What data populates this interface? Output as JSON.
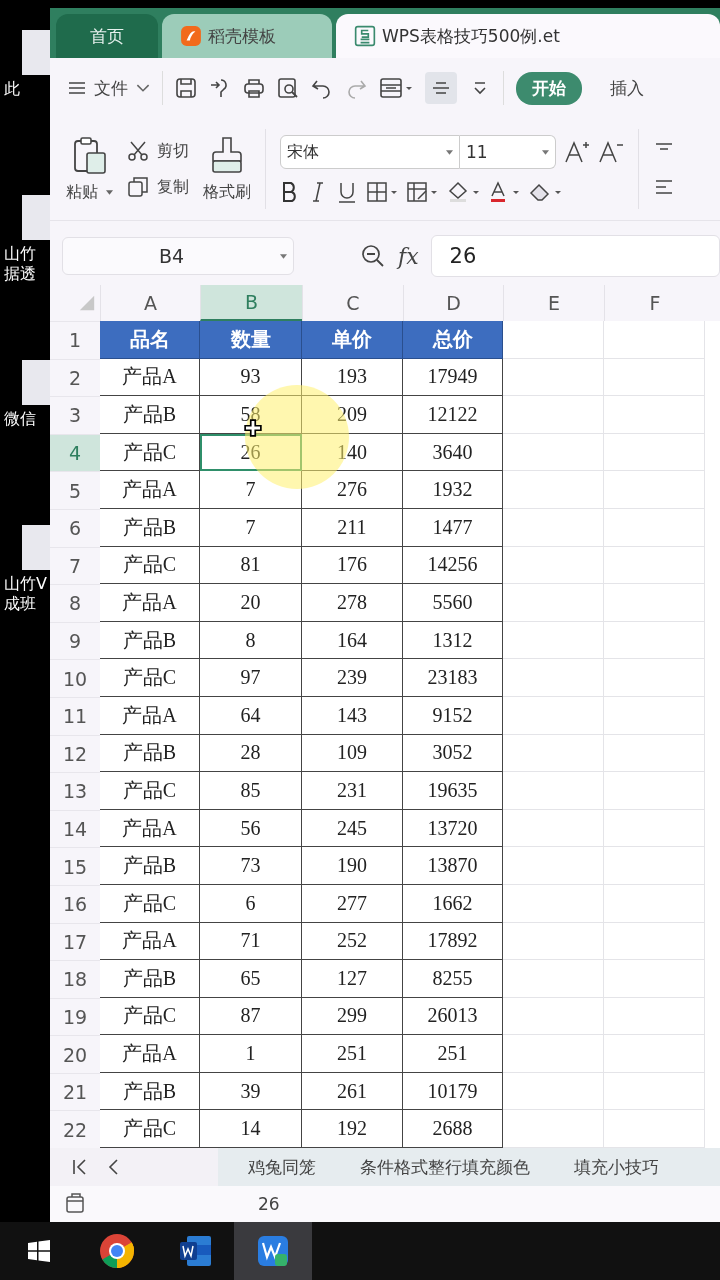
{
  "desktop_icons": [
    {
      "lines": [
        "此"
      ]
    },
    {
      "lines": [
        "山竹",
        "据透"
      ]
    },
    {
      "lines": [
        "微信"
      ]
    },
    {
      "lines": [
        "山竹V",
        "成班"
      ]
    }
  ],
  "tabs": [
    {
      "label": "首页",
      "kind": "home",
      "selected": false
    },
    {
      "label": "稻壳模板",
      "kind": "template",
      "selected": false
    },
    {
      "label": "WPS表格技巧500例.et",
      "kind": "document",
      "selected": true
    }
  ],
  "toolbar": {
    "file_menu": "文件"
  },
  "ribbon_tabs": [
    {
      "label": "开始",
      "selected": true
    },
    {
      "label": "插入",
      "selected": false
    }
  ],
  "ribbon": {
    "paste": "粘贴",
    "cut": "剪切",
    "copy": "复制",
    "format_painter": "格式刷",
    "font": "宋体",
    "font_size": "11"
  },
  "formula_bar": {
    "name_box": "B4",
    "fx": "fx",
    "value": "26"
  },
  "sheet": {
    "columns": [
      {
        "label": "A",
        "selected": false
      },
      {
        "label": "B",
        "selected": true
      },
      {
        "label": "C",
        "selected": false
      },
      {
        "label": "D",
        "selected": false
      },
      {
        "label": "E",
        "selected": false
      },
      {
        "label": "F",
        "selected": false
      }
    ],
    "rows": [
      {
        "number": "1",
        "kind": "header",
        "selected": false,
        "cells": [
          "品名",
          "数量",
          "单价",
          "总价"
        ]
      },
      {
        "number": "2",
        "kind": "data",
        "selected": false,
        "cells": [
          "产品A",
          "93",
          "193",
          "17949"
        ]
      },
      {
        "number": "3",
        "kind": "data",
        "selected": false,
        "cells": [
          "产品B",
          "58",
          "209",
          "12122"
        ]
      },
      {
        "number": "4",
        "kind": "data",
        "selected": true,
        "cells": [
          "产品C",
          "26",
          "140",
          "3640"
        ]
      },
      {
        "number": "5",
        "kind": "data",
        "selected": false,
        "cells": [
          "产品A",
          "7",
          "276",
          "1932"
        ]
      },
      {
        "number": "6",
        "kind": "data",
        "selected": false,
        "cells": [
          "产品B",
          "7",
          "211",
          "1477"
        ]
      },
      {
        "number": "7",
        "kind": "data",
        "selected": false,
        "cells": [
          "产品C",
          "81",
          "176",
          "14256"
        ]
      },
      {
        "number": "8",
        "kind": "data",
        "selected": false,
        "cells": [
          "产品A",
          "20",
          "278",
          "5560"
        ]
      },
      {
        "number": "9",
        "kind": "data",
        "selected": false,
        "cells": [
          "产品B",
          "8",
          "164",
          "1312"
        ]
      },
      {
        "number": "10",
        "kind": "data",
        "selected": false,
        "cells": [
          "产品C",
          "97",
          "239",
          "23183"
        ]
      },
      {
        "number": "11",
        "kind": "data",
        "selected": false,
        "cells": [
          "产品A",
          "64",
          "143",
          "9152"
        ]
      },
      {
        "number": "12",
        "kind": "data",
        "selected": false,
        "cells": [
          "产品B",
          "28",
          "109",
          "3052"
        ]
      },
      {
        "number": "13",
        "kind": "data",
        "selected": false,
        "cells": [
          "产品C",
          "85",
          "231",
          "19635"
        ]
      },
      {
        "number": "14",
        "kind": "data",
        "selected": false,
        "cells": [
          "产品A",
          "56",
          "245",
          "13720"
        ]
      },
      {
        "number": "15",
        "kind": "data",
        "selected": false,
        "cells": [
          "产品B",
          "73",
          "190",
          "13870"
        ]
      },
      {
        "number": "16",
        "kind": "data",
        "selected": false,
        "cells": [
          "产品C",
          "6",
          "277",
          "1662"
        ]
      },
      {
        "number": "17",
        "kind": "data",
        "selected": false,
        "cells": [
          "产品A",
          "71",
          "252",
          "17892"
        ]
      },
      {
        "number": "18",
        "kind": "data",
        "selected": false,
        "cells": [
          "产品B",
          "65",
          "127",
          "8255"
        ]
      },
      {
        "number": "19",
        "kind": "data",
        "selected": false,
        "cells": [
          "产品C",
          "87",
          "299",
          "26013"
        ]
      },
      {
        "number": "20",
        "kind": "data",
        "selected": false,
        "cells": [
          "产品A",
          "1",
          "251",
          "251"
        ]
      },
      {
        "number": "21",
        "kind": "data",
        "selected": false,
        "cells": [
          "产品B",
          "39",
          "261",
          "10179"
        ]
      },
      {
        "number": "22",
        "kind": "data",
        "selected": false,
        "cells": [
          "产品C",
          "14",
          "192",
          "2688"
        ]
      }
    ]
  },
  "sheet_tabs": [
    {
      "label": "鸡兔同笼"
    },
    {
      "label": "条件格式整行填充颜色"
    },
    {
      "label": "填充小技巧"
    }
  ],
  "status_bar": {
    "value": "26"
  },
  "taskbar": [
    {
      "kind": "start",
      "selected": false
    },
    {
      "kind": "chrome",
      "selected": false
    },
    {
      "kind": "word",
      "selected": false
    },
    {
      "kind": "wps",
      "selected": true
    }
  ]
}
